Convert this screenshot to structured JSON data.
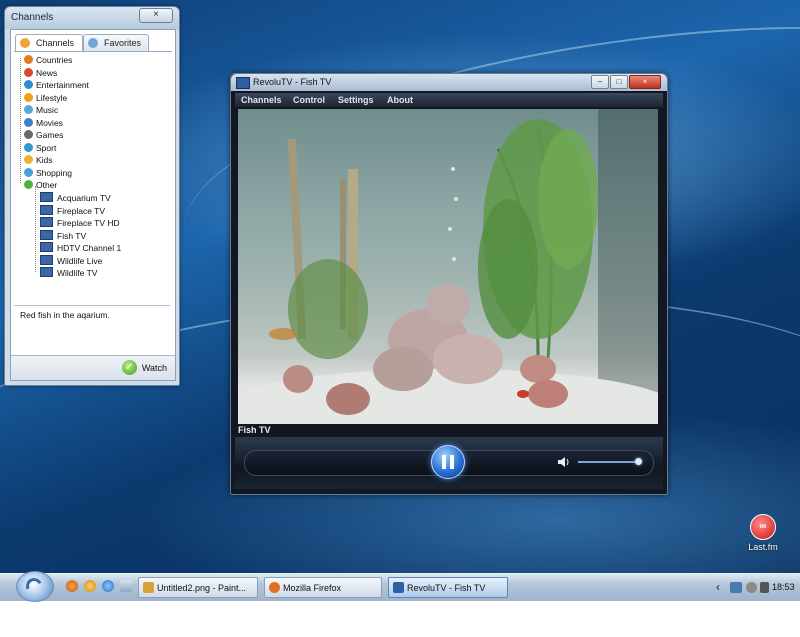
{
  "channels_window": {
    "title": "Channels",
    "close_label": "×",
    "tabs": [
      {
        "label": "Channels",
        "icon": "channels-tab-icon",
        "active": true
      },
      {
        "label": "Favorites",
        "icon": "star-icon",
        "active": false
      }
    ],
    "categories": [
      {
        "label": "Countries",
        "color": "#e07b22"
      },
      {
        "label": "News",
        "color": "#d9482b"
      },
      {
        "label": "Entertainment",
        "color": "#2d8fd1"
      },
      {
        "label": "Lifestyle",
        "color": "#e9a317"
      },
      {
        "label": "Music",
        "color": "#55a8d8"
      },
      {
        "label": "Movies",
        "color": "#3f7fc4"
      },
      {
        "label": "Games",
        "color": "#6a6a6a"
      },
      {
        "label": "Sport",
        "color": "#2f9bd0"
      },
      {
        "label": "Kids",
        "color": "#e7b531"
      },
      {
        "label": "Shopping",
        "color": "#4aa0d8"
      },
      {
        "label": "Other",
        "color": "#4fb23c"
      }
    ],
    "other_channels": [
      "Acquarium TV",
      "Fireplace TV",
      "Fireplace TV HD",
      "Fish TV",
      "HDTV Channel 1",
      "Wildlife Live",
      "Wildlife TV"
    ],
    "description": "Red fish in the aqarium.",
    "watch_label": "Watch"
  },
  "player_window": {
    "title": "RevoluTV - Fish TV",
    "menu": [
      "Channels",
      "Control",
      "Settings",
      "About"
    ],
    "buttons": {
      "minimize": "–",
      "maximize": "□",
      "close": "×"
    },
    "now_playing": "Fish TV",
    "state": "playing",
    "volume": 0.95
  },
  "desktop_icons": [
    {
      "label": "Last.fm",
      "icon": "lastfm-icon",
      "glyph": "∞"
    }
  ],
  "taskbar": {
    "items": [
      {
        "label": "Untitled2.png - Paint...",
        "icon": "paint-icon",
        "color": "#d8a13a",
        "active": false
      },
      {
        "label": "Mozilla Firefox",
        "icon": "firefox-icon",
        "color": "#e0701e",
        "active": false
      },
      {
        "label": "RevoluTV - Fish TV",
        "icon": "revolutv-icon",
        "color": "#2f5fa3",
        "active": true
      }
    ],
    "chevron": "‹",
    "clock": "18:53"
  }
}
